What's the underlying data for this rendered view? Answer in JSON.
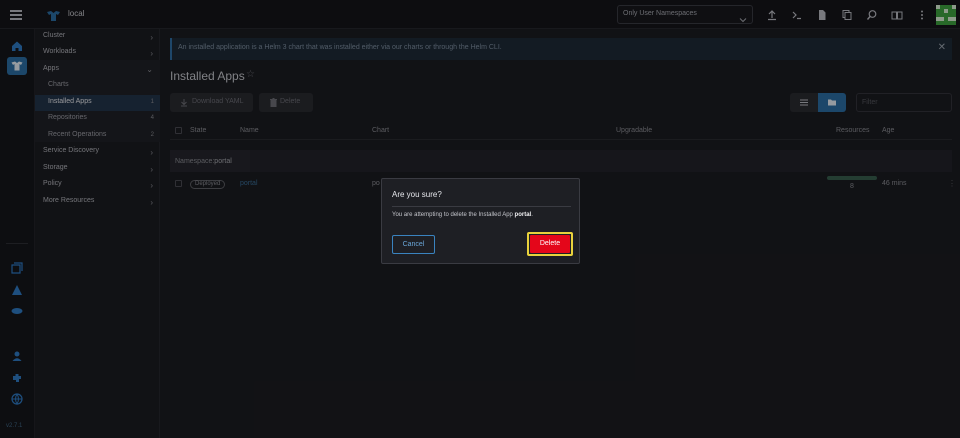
{
  "topbar": {
    "cluster_name": "local",
    "namespace_filter": "Only User Namespaces",
    "icons": [
      "import-yaml-icon",
      "kubectl-shell-icon",
      "kubeconfig-download-icon",
      "copy-kubeconfig-icon",
      "search-icon",
      "notes-icon",
      "more-vert-icon"
    ]
  },
  "rail": {
    "version": "v2.7.1"
  },
  "nav": {
    "items": [
      {
        "label": "Cluster",
        "type": "group"
      },
      {
        "label": "Workloads",
        "type": "group"
      },
      {
        "label": "Apps",
        "type": "group-open"
      },
      {
        "label": "Charts",
        "type": "sub"
      },
      {
        "label": "Installed Apps",
        "type": "sub-active",
        "count": "1"
      },
      {
        "label": "Repositories",
        "type": "sub",
        "count": "4"
      },
      {
        "label": "Recent Operations",
        "type": "sub",
        "count": "2"
      },
      {
        "label": "Service Discovery",
        "type": "group"
      },
      {
        "label": "Storage",
        "type": "group"
      },
      {
        "label": "Policy",
        "type": "group"
      },
      {
        "label": "More Resources",
        "type": "group"
      }
    ]
  },
  "main": {
    "banner": "An installed application is a Helm 3 chart that was installed either via our charts or through the Helm CLI.",
    "title": "Installed Apps",
    "download_yaml_label": "Download YAML",
    "delete_label": "Delete",
    "filter_placeholder": "Filter",
    "columns": {
      "state": "State",
      "name": "Name",
      "chart": "Chart",
      "upgradable": "Upgradable",
      "resources": "Resources",
      "age": "Age"
    },
    "namespace_row": {
      "prefix": "Namespace:",
      "name": "portal"
    },
    "row": {
      "state": "Deployed",
      "name": "portal",
      "chart": "po",
      "resources": "8",
      "resources_ready_fraction": 1.0,
      "age": "46 mins"
    }
  },
  "dialog": {
    "title": "Are you sure?",
    "message_prefix": "You are attempting to delete the Installed App ",
    "message_target": "portal",
    "message_suffix": ".",
    "cancel_label": "Cancel",
    "confirm_label": "Delete"
  },
  "colors": {
    "accent": "#2b6ea4",
    "danger": "#e4061a",
    "highlight": "#e9d23c"
  }
}
